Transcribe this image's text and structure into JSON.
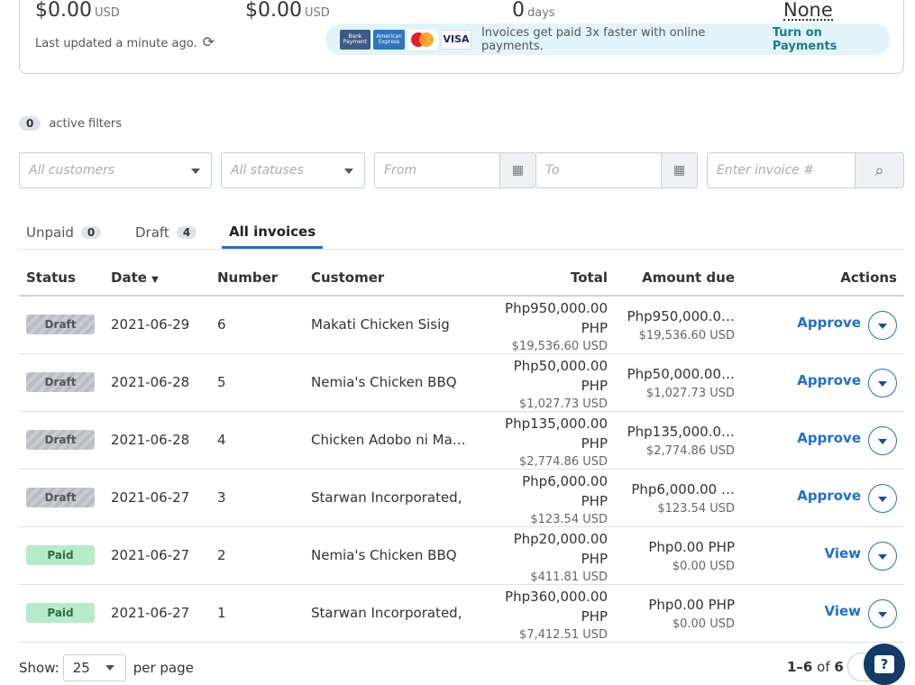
{
  "summary": {
    "values": [
      {
        "amount": "$0.00",
        "unit": "USD"
      },
      {
        "amount": "$0.00",
        "unit": "USD"
      },
      {
        "amount": "0",
        "unit": "days"
      }
    ],
    "none_label": "None",
    "last_updated": "Last updated a minute ago.",
    "banner": {
      "cards": [
        "Bank Payment",
        "American Express",
        "Mastercard",
        "VISA"
      ],
      "text": "Invoices get paid 3x faster with online payments.",
      "link": "Turn on Payments"
    }
  },
  "filters": {
    "count": "0",
    "label": "active filters",
    "customers": "All customers",
    "statuses": "All statuses",
    "from": "From",
    "to": "To",
    "invoice": "Enter invoice #"
  },
  "tabs": [
    {
      "label": "Unpaid",
      "count": "0"
    },
    {
      "label": "Draft",
      "count": "4"
    },
    {
      "label": "All invoices"
    }
  ],
  "table": {
    "headers": {
      "status": "Status",
      "date": "Date",
      "number": "Number",
      "customer": "Customer",
      "total": "Total",
      "amount_due": "Amount due",
      "actions": "Actions"
    },
    "rows": [
      {
        "status": "Draft",
        "date": "2021-06-29",
        "number": "6",
        "customer": "Makati Chicken Sisig",
        "total": "Php950,000.00",
        "total_cur": "PHP",
        "total_usd": "$19,536.60  USD",
        "due": "Php950,000.0…",
        "due_usd": "$19,536.60  USD",
        "action": "Approve"
      },
      {
        "status": "Draft",
        "date": "2021-06-28",
        "number": "5",
        "customer": "Nemia's Chicken BBQ",
        "total": "Php50,000.00",
        "total_cur": "PHP",
        "total_usd": "$1,027.73  USD",
        "due": "Php50,000.00…",
        "due_usd": "$1,027.73  USD",
        "action": "Approve"
      },
      {
        "status": "Draft",
        "date": "2021-06-28",
        "number": "4",
        "customer": "Chicken Adobo ni Ma…",
        "total": "Php135,000.00",
        "total_cur": "PHP",
        "total_usd": "$2,774.86  USD",
        "due": "Php135,000.0…",
        "due_usd": "$2,774.86  USD",
        "action": "Approve"
      },
      {
        "status": "Draft",
        "date": "2021-06-27",
        "number": "3",
        "customer": "Starwan Incorporated,",
        "total": "Php6,000.00",
        "total_cur": "PHP",
        "total_usd": "$123.54  USD",
        "due": "Php6,000.00  …",
        "due_usd": "$123.54  USD",
        "action": "Approve"
      },
      {
        "status": "Paid",
        "date": "2021-06-27",
        "number": "2",
        "customer": "Nemia's Chicken BBQ",
        "total": "Php20,000.00",
        "total_cur": "PHP",
        "total_usd": "$411.81  USD",
        "due": "Php0.00  PHP",
        "due_usd": "$0.00  USD",
        "action": "View"
      },
      {
        "status": "Paid",
        "date": "2021-06-27",
        "number": "1",
        "customer": "Starwan Incorporated,",
        "total": "Php360,000.00",
        "total_cur": "PHP",
        "total_usd": "$7,412.51  USD",
        "due": "Php0.00  PHP",
        "due_usd": "$0.00  USD",
        "action": "View"
      }
    ]
  },
  "footer": {
    "show": "Show:",
    "per_page_value": "25",
    "per_page": "per page",
    "range": "1–6",
    "of": "of",
    "total": "6"
  }
}
